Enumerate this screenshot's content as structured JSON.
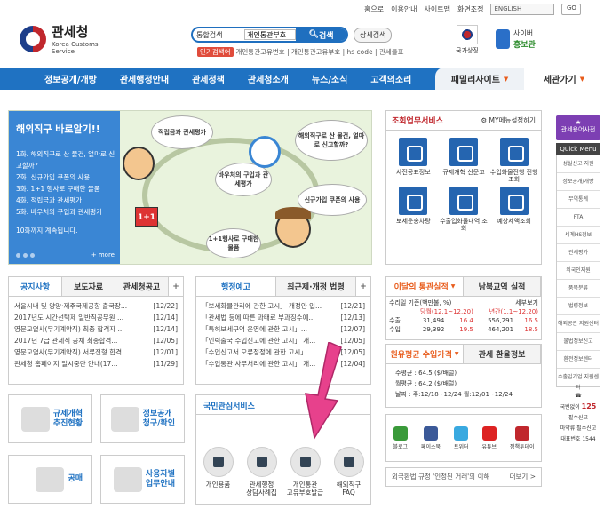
{
  "util": {
    "home": "홈으로",
    "how_to_use": "이용안내",
    "sitemap": "사이트맵",
    "screen": "화면조정",
    "language": "ENGLISH",
    "go": "GO"
  },
  "logo": {
    "ko": "관세청",
    "en1": "Korea Customs",
    "en2": "Service"
  },
  "search": {
    "scope": "통합검색",
    "value": "개인통관부호",
    "button": "검색",
    "detail": "상세검색"
  },
  "popular": {
    "tag": "인기검색어",
    "terms": "개인통관고유번호 | 개인통관고유부호 | hs code | 관세율표"
  },
  "symbol": {
    "label": "국가상징"
  },
  "cyber": {
    "top": "사이버",
    "main": "홍보관"
  },
  "nav": {
    "items": [
      "정보공개/개방",
      "관세행정안내",
      "관세정책",
      "관세청소개",
      "뉴스/소식",
      "고객의소리"
    ],
    "family": "패밀리사이트",
    "sub": "세관가기"
  },
  "banner": {
    "title": "해외직구 바로알기!!",
    "items": [
      "1화. 해외직구로 산 물건, 얼마로 신고할까?",
      "2화. 신규가입 쿠폰의 사용",
      "3화. 1+1 행사로 구매한 물품",
      "4화. 적립금과 관세평가",
      "5화. 바우처의 구입과 관세평가",
      "10화까지 계속됩니다."
    ],
    "more": "+ more",
    "b1": "적립금과 관세평가",
    "b2": "해외직구로 산 물건, 얼마로 신고할까?",
    "b3": "바우처의 구입과 관세평가",
    "b4": "신규가입 쿠폰의 사용",
    "b5": "1+1행사로 구매한 물품",
    "sign": "1+1"
  },
  "svc": {
    "title": "조회업무서비스",
    "my": "MY메뉴설정하기",
    "items": [
      "사전공표정보",
      "규제개혁 신문고",
      "수입화물진행 진행조회",
      "보세운송차량",
      "수출입화물내역 조회",
      "예상세액조회"
    ]
  },
  "qm": {
    "dict": "관세용어사전",
    "head": "Quick Menu",
    "items": [
      "성실신고 지원",
      "정보공개/개방",
      "무역통계",
      "FTA",
      "세계HS정보",
      "관세평가",
      "외국인지원",
      "품목분류",
      "법령정보",
      "해외공관 지원센터",
      "불법정보신고",
      "환전정보센터",
      "수출입기업 지원센터"
    ],
    "phone_label": "국번없이",
    "phone": "125",
    "stamp1": "필수신고",
    "stamp2": "마약류 필수신고",
    "footer": "대표번호 1544"
  },
  "b1": {
    "tabs": [
      "공지사항",
      "보도자료",
      "관세청공고"
    ],
    "rows": [
      [
        "서울시내 및 양양·제주국제공항 출국장...",
        "[12/22]"
      ],
      [
        "2017년도 시간선택제 일반직공무원 ...",
        "[12/14]"
      ],
      [
        "영문교열사(무기계약직) 최종 합격자 ...",
        "[12/14]"
      ],
      [
        "2017년 7급 관세직 공채 최종합격...",
        "[12/05]"
      ],
      [
        "영문교열사(무기계약직) 서류전형 합격...",
        "[12/01]"
      ],
      [
        "관세청 홈페이지 일시중단 안내(17...",
        "[11/29]"
      ]
    ]
  },
  "b2": {
    "tabs": [
      "행정예고",
      "최근제·개정 법령"
    ],
    "rows": [
      [
        "「보세화물관리에 관한 고시」 개정안 입...",
        "[12/21]"
      ],
      [
        "「관세법 등에 따른 과태료 부과징수에...",
        "[12/13]"
      ],
      [
        "「특허보세구역 운영에 관한 고시」...",
        "[12/07]"
      ],
      [
        "「인력출국 수입신고에 관한 고시」 개...",
        "[12/05]"
      ],
      [
        "「수입신고서 오류정정에 관한 고시」...",
        "[12/05]"
      ],
      [
        "「수입통관 사무처리에 관한 고시」 개...",
        "[12/04]"
      ]
    ]
  },
  "stats": {
    "tabs": [
      "이달의 통관실적",
      "남북교역 실적"
    ],
    "unit": "세부보기",
    "head1": "수리일 기준(백만불, %)",
    "head2": "당월(12.1~12.20)",
    "head3": "년간(1.1~12.20)",
    "rows": [
      [
        "수출",
        "31,494",
        "16.4",
        "556,291",
        "16.5"
      ],
      [
        "수입",
        "29,392",
        "19.5",
        "464,201",
        "18.5"
      ]
    ]
  },
  "fx": {
    "tabs": [
      "원유평균 수입가격",
      "관세 환율정보"
    ],
    "lines": [
      "주평균 : 64.5 ($/배럴)",
      "월평균 : 64.2 ($/배럴)",
      "날짜 : 주:12/18~12/24  월:12/01~12/24"
    ]
  },
  "left": {
    "b1": [
      "규제개혁",
      "추진현황"
    ],
    "b2": [
      "정보공개",
      "청구/확인"
    ],
    "b3": [
      "공매"
    ],
    "b4": [
      "사용자별",
      "업무안내"
    ]
  },
  "nat": {
    "title": "국민관심서비스",
    "items": [
      [
        "개인용품"
      ],
      [
        "관세행정",
        "상담사례집"
      ],
      [
        "개인통관",
        "고유부호발급"
      ],
      [
        "해외직구",
        "FAQ"
      ]
    ]
  },
  "sns": {
    "items": [
      "블로그",
      "페이스북",
      "트위터",
      "유튜브",
      "정책투데이"
    ]
  },
  "banner2": {
    "text": "외국환법 규정 '인정된 거래'의 이해",
    "more": "더보기 >"
  }
}
